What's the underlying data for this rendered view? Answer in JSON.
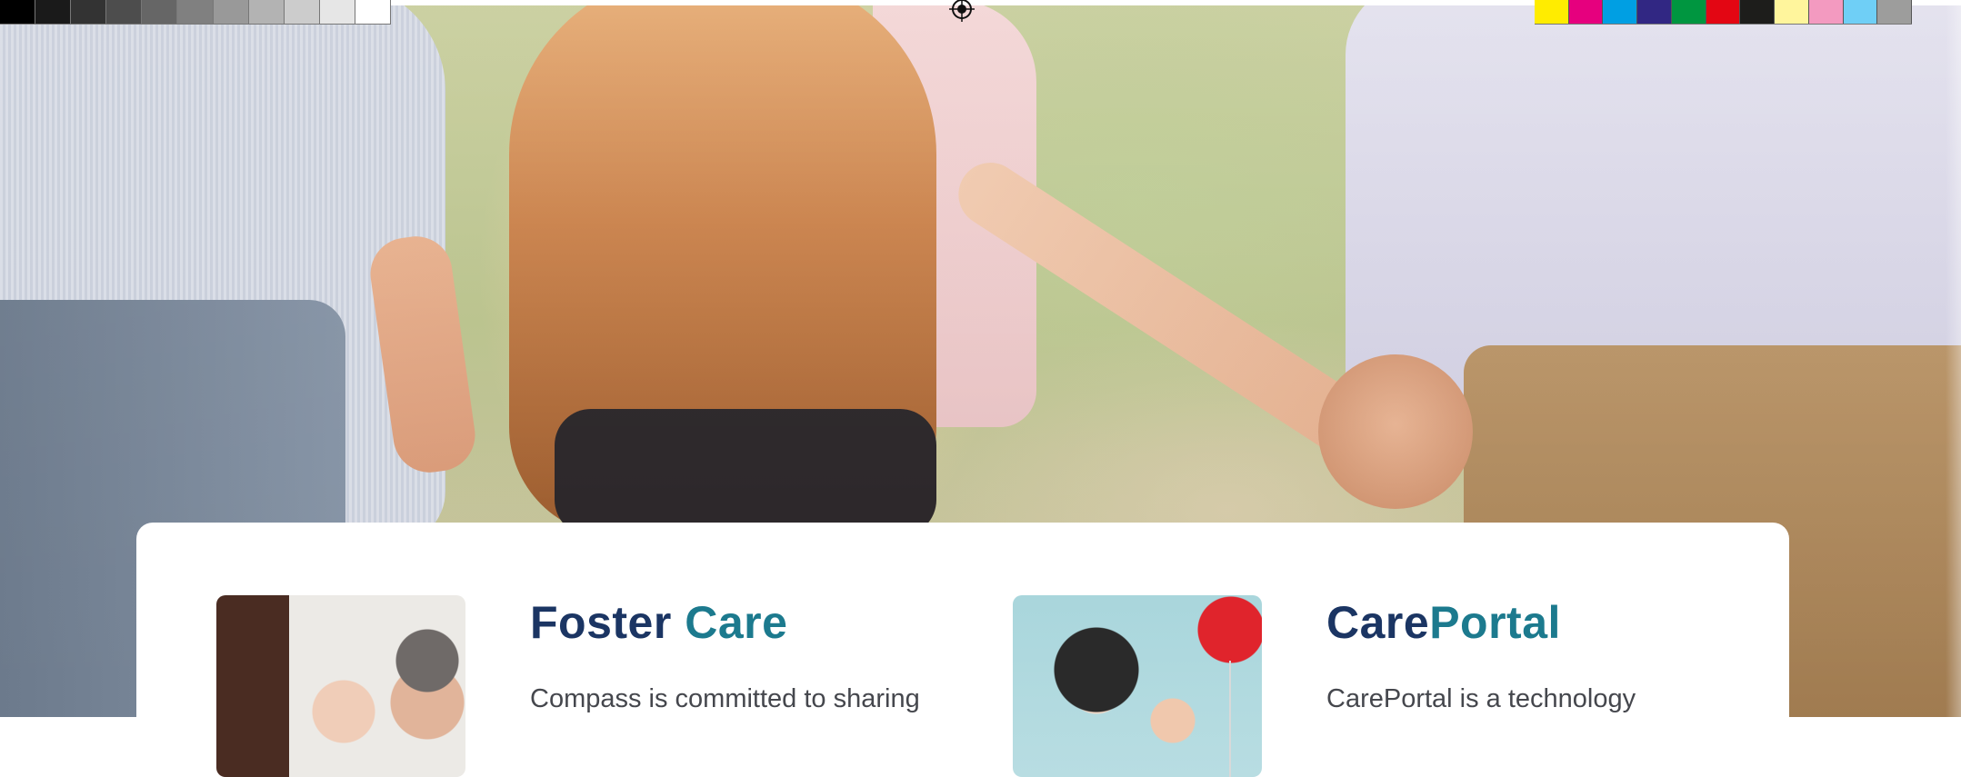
{
  "programs": [
    {
      "title_part1": "Foster",
      "title_part2": "Care",
      "text": "Compass is committed to sharing"
    },
    {
      "title_part1": "Care",
      "title_part2": "Portal",
      "text": "CarePortal is a technology"
    }
  ],
  "colors": {
    "title_navy": "#1b3563",
    "title_teal": "#1c7a8e",
    "body_text": "#45474d",
    "card_bg": "#ffffff"
  },
  "print_marks": {
    "gray_steps": [
      "#000000",
      "#1a1a1a",
      "#333333",
      "#4d4d4d",
      "#666666",
      "#808080",
      "#999999",
      "#b3b3b3",
      "#cccccc",
      "#e6e6e6",
      "#ffffff"
    ],
    "color_swatches": [
      "#ffec00",
      "#e6007e",
      "#009fe3",
      "#312783",
      "#009640",
      "#e30613",
      "#1d1d1b",
      "#fff59c",
      "#f39ac0",
      "#6fcff6",
      "#9d9d9c"
    ]
  }
}
